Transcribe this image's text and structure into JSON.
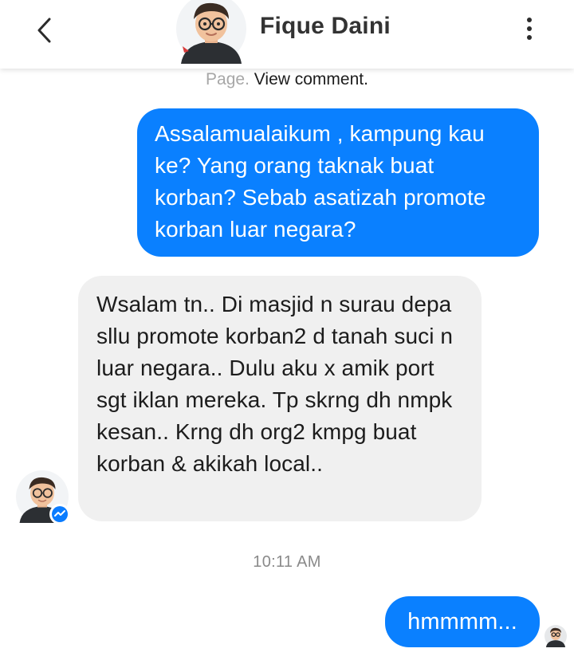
{
  "header": {
    "contact_name": "Fique Daini",
    "back_icon": "chevron-left-icon",
    "more_icon": "vertical-ellipsis-icon"
  },
  "page_note": {
    "muted_text": "Page.",
    "link_text": "View comment."
  },
  "messages": [
    {
      "direction": "outgoing",
      "text": "Assalamualaikum , kampung kau ke? Yang orang taknak buat korban? Sebab asatizah promote korban luar negara?"
    },
    {
      "direction": "incoming",
      "text": "Wsalam tn.. Di masjid n surau depa sllu promote korban2 d tanah suci n luar negara..  Dulu aku x amik port sgt iklan mereka. Tp skrng dh nmpk kesan.. Krng dh org2 kmpg buat korban  & akikah local.."
    },
    {
      "direction": "outgoing",
      "text": "hmmmm..."
    }
  ],
  "timestamp": "10:11 AM",
  "colors": {
    "outgoing_bubble": "#0a80ff",
    "incoming_bubble": "#f0f0f0",
    "messenger_badge": "#0a7cff"
  }
}
